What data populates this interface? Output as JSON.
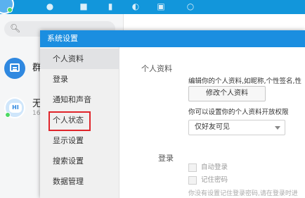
{
  "main_window": {
    "header_color": "#1296db",
    "search_icon": "search-icon",
    "chats": [
      {
        "name": "群",
        "icon": "group-chat-icon"
      },
      {
        "name": "无",
        "subtitle": "16",
        "avatar_text": "HI",
        "icon": "hi-bubble-icon"
      }
    ]
  },
  "dialog": {
    "title": "系统设置",
    "title_bar_color": "#1b8ee0",
    "nav": [
      {
        "label": "个人资料",
        "active": true
      },
      {
        "label": "登录"
      },
      {
        "label": "通知和声音"
      },
      {
        "label": "个人状态",
        "highlighted": true
      },
      {
        "label": "显示设置"
      },
      {
        "label": "搜索设置"
      },
      {
        "label": "数据管理"
      }
    ],
    "highlight_color": "#e0252b",
    "profile_section": {
      "label": "个人资料",
      "description": "编辑你的个人资料,如昵称,个性签名,性",
      "edit_button": "修改个人资料",
      "permission_text": "你可以设置你的个人资料开放权限",
      "permission_value": "仅好友可见"
    },
    "login_section": {
      "label": "登录",
      "auto_login": "自动登录",
      "remember_password": "记住密码",
      "hint": "你没有设置记住登录密码,请在登录时进"
    }
  }
}
